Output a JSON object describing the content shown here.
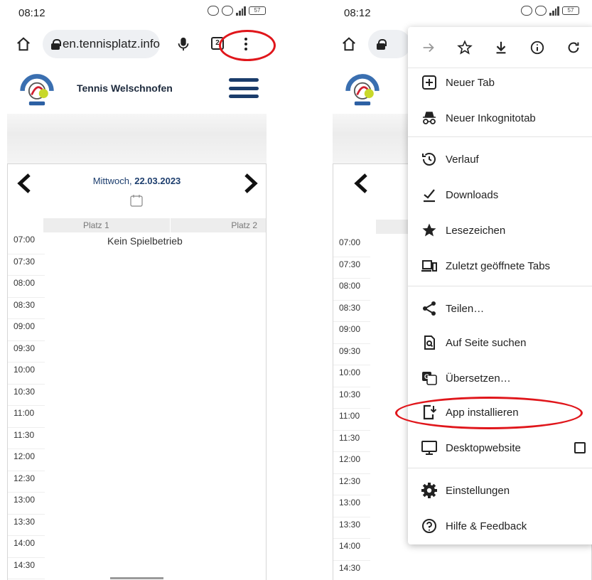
{
  "status_bar": {
    "time": "08:12",
    "battery": "57"
  },
  "browser": {
    "url": "en.tennisplatz.info",
    "tab_count": "2"
  },
  "site": {
    "title": "Tennis Welschnofen"
  },
  "booking": {
    "weekday": "Mittwoch,",
    "date": "22.03.2023",
    "courts": [
      "Platz 1",
      "Platz 2"
    ],
    "no_play": "Kein Spielbetrieb",
    "times": [
      "07:00",
      "07:30",
      "08:00",
      "08:30",
      "09:00",
      "09:30",
      "10:00",
      "10:30",
      "11:00",
      "11:30",
      "12:00",
      "12:30",
      "13:00",
      "13:30",
      "14:00",
      "14:30"
    ]
  },
  "menu": {
    "top_icons": [
      "forward-icon",
      "star-icon",
      "download-icon",
      "info-icon",
      "reload-icon"
    ],
    "items": [
      {
        "label": "Neuer Tab",
        "icon": "new-tab-icon"
      },
      {
        "label": "Neuer Inkognitotab",
        "icon": "incognito-icon"
      },
      {
        "label": "Verlauf",
        "icon": "history-icon"
      },
      {
        "label": "Downloads",
        "icon": "downloads-icon"
      },
      {
        "label": "Lesezeichen",
        "icon": "bookmarks-icon"
      },
      {
        "label": "Zuletzt geöffnete Tabs",
        "icon": "recent-tabs-icon"
      },
      {
        "label": "Teilen…",
        "icon": "share-icon"
      },
      {
        "label": "Auf Seite suchen",
        "icon": "find-icon"
      },
      {
        "label": "Übersetzen…",
        "icon": "translate-icon"
      },
      {
        "label": "App installieren",
        "icon": "install-app-icon"
      },
      {
        "label": "Desktopwebsite",
        "icon": "desktop-icon"
      },
      {
        "label": "Einstellungen",
        "icon": "settings-icon"
      },
      {
        "label": "Hilfe & Feedback",
        "icon": "help-icon"
      }
    ]
  },
  "colors": {
    "highlight": "#e0161b",
    "accent": "#1a3c6b"
  }
}
